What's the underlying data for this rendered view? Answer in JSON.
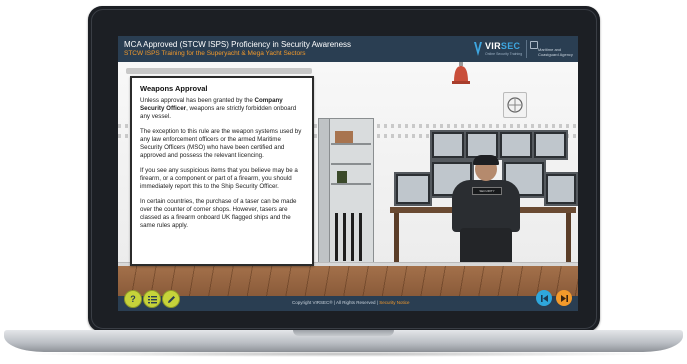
{
  "colors": {
    "header_bg": "#2a3e52",
    "subtitle_accent": "#f39a2b",
    "help_button": "#c6d33a",
    "prev_button": "#2fa7dc",
    "next_button": "#f39a2b"
  },
  "header": {
    "title": "MCA Approved (STCW ISPS) Proficiency in Security Awareness",
    "subtitle": "STCW ISPS Training for the Superyacht & Mega Yacht Sectors",
    "logo": {
      "brand_part1": "VIR",
      "brand_part2": "SEC",
      "tagline": "Online Security Training"
    },
    "partner": {
      "line1": "Maritime and",
      "line2": "Coastguard Agency"
    }
  },
  "content": {
    "heading": "Weapons Approval",
    "para1_before": "Unless approval has been granted by the ",
    "para1_bold": "Company Security Officer",
    "para1_after": ", weapons are strictly forbidden onboard any vessel.",
    "para2": "The exception to this rule are the weapon systems used by any law enforcement officers or the armed Maritime Security Officers (MSO) who have been certified and approved and possess the relevant licencing.",
    "para3": "If you see any suspicious items that you believe may be a firearm, or a component or part of a firearm, you should immediately report this to the Ship Security Officer.",
    "para4": "In certain countries, the purchase of a taser can be made over the counter of corner shops. However, tasers are classed as a firearm onboard UK flagged ships and the same rules apply."
  },
  "scene": {
    "badge_text": "SECURITY"
  },
  "footer": {
    "copyright": "Copyright VIRSEC® | All Rights Reserved | ",
    "link": "Security Notice",
    "help_icon": "question-icon",
    "menu_icon": "list-icon",
    "notes_icon": "pencil-icon",
    "prev_icon": "skip-back-icon",
    "next_icon": "skip-forward-icon"
  }
}
